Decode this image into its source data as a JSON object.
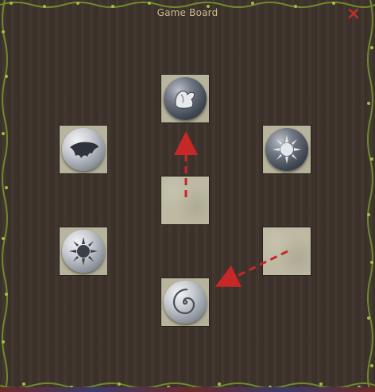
{
  "window": {
    "title": "Game Board"
  },
  "board": {
    "tiles": [
      {
        "row": 0,
        "col": 1,
        "token": "dark",
        "icon": "flexed-arm-icon"
      },
      {
        "row": 1,
        "col": 0,
        "token": "light",
        "icon": "wing-icon"
      },
      {
        "row": 1,
        "col": 2,
        "token": "dark",
        "icon": "sun-icon"
      },
      {
        "row": 2,
        "col": 1,
        "token": null,
        "icon": null
      },
      {
        "row": 3,
        "col": 0,
        "token": "light",
        "icon": "sun-icon"
      },
      {
        "row": 3,
        "col": 2,
        "token": null,
        "icon": null
      },
      {
        "row": 4,
        "col": 1,
        "token": "light",
        "icon": "swirl-icon"
      }
    ],
    "moves": [
      {
        "from": "row2-col1",
        "to": "row0-col1"
      },
      {
        "from": "row3-col2",
        "to": "row4-col1"
      }
    ],
    "arrow_color": "#c62828"
  }
}
